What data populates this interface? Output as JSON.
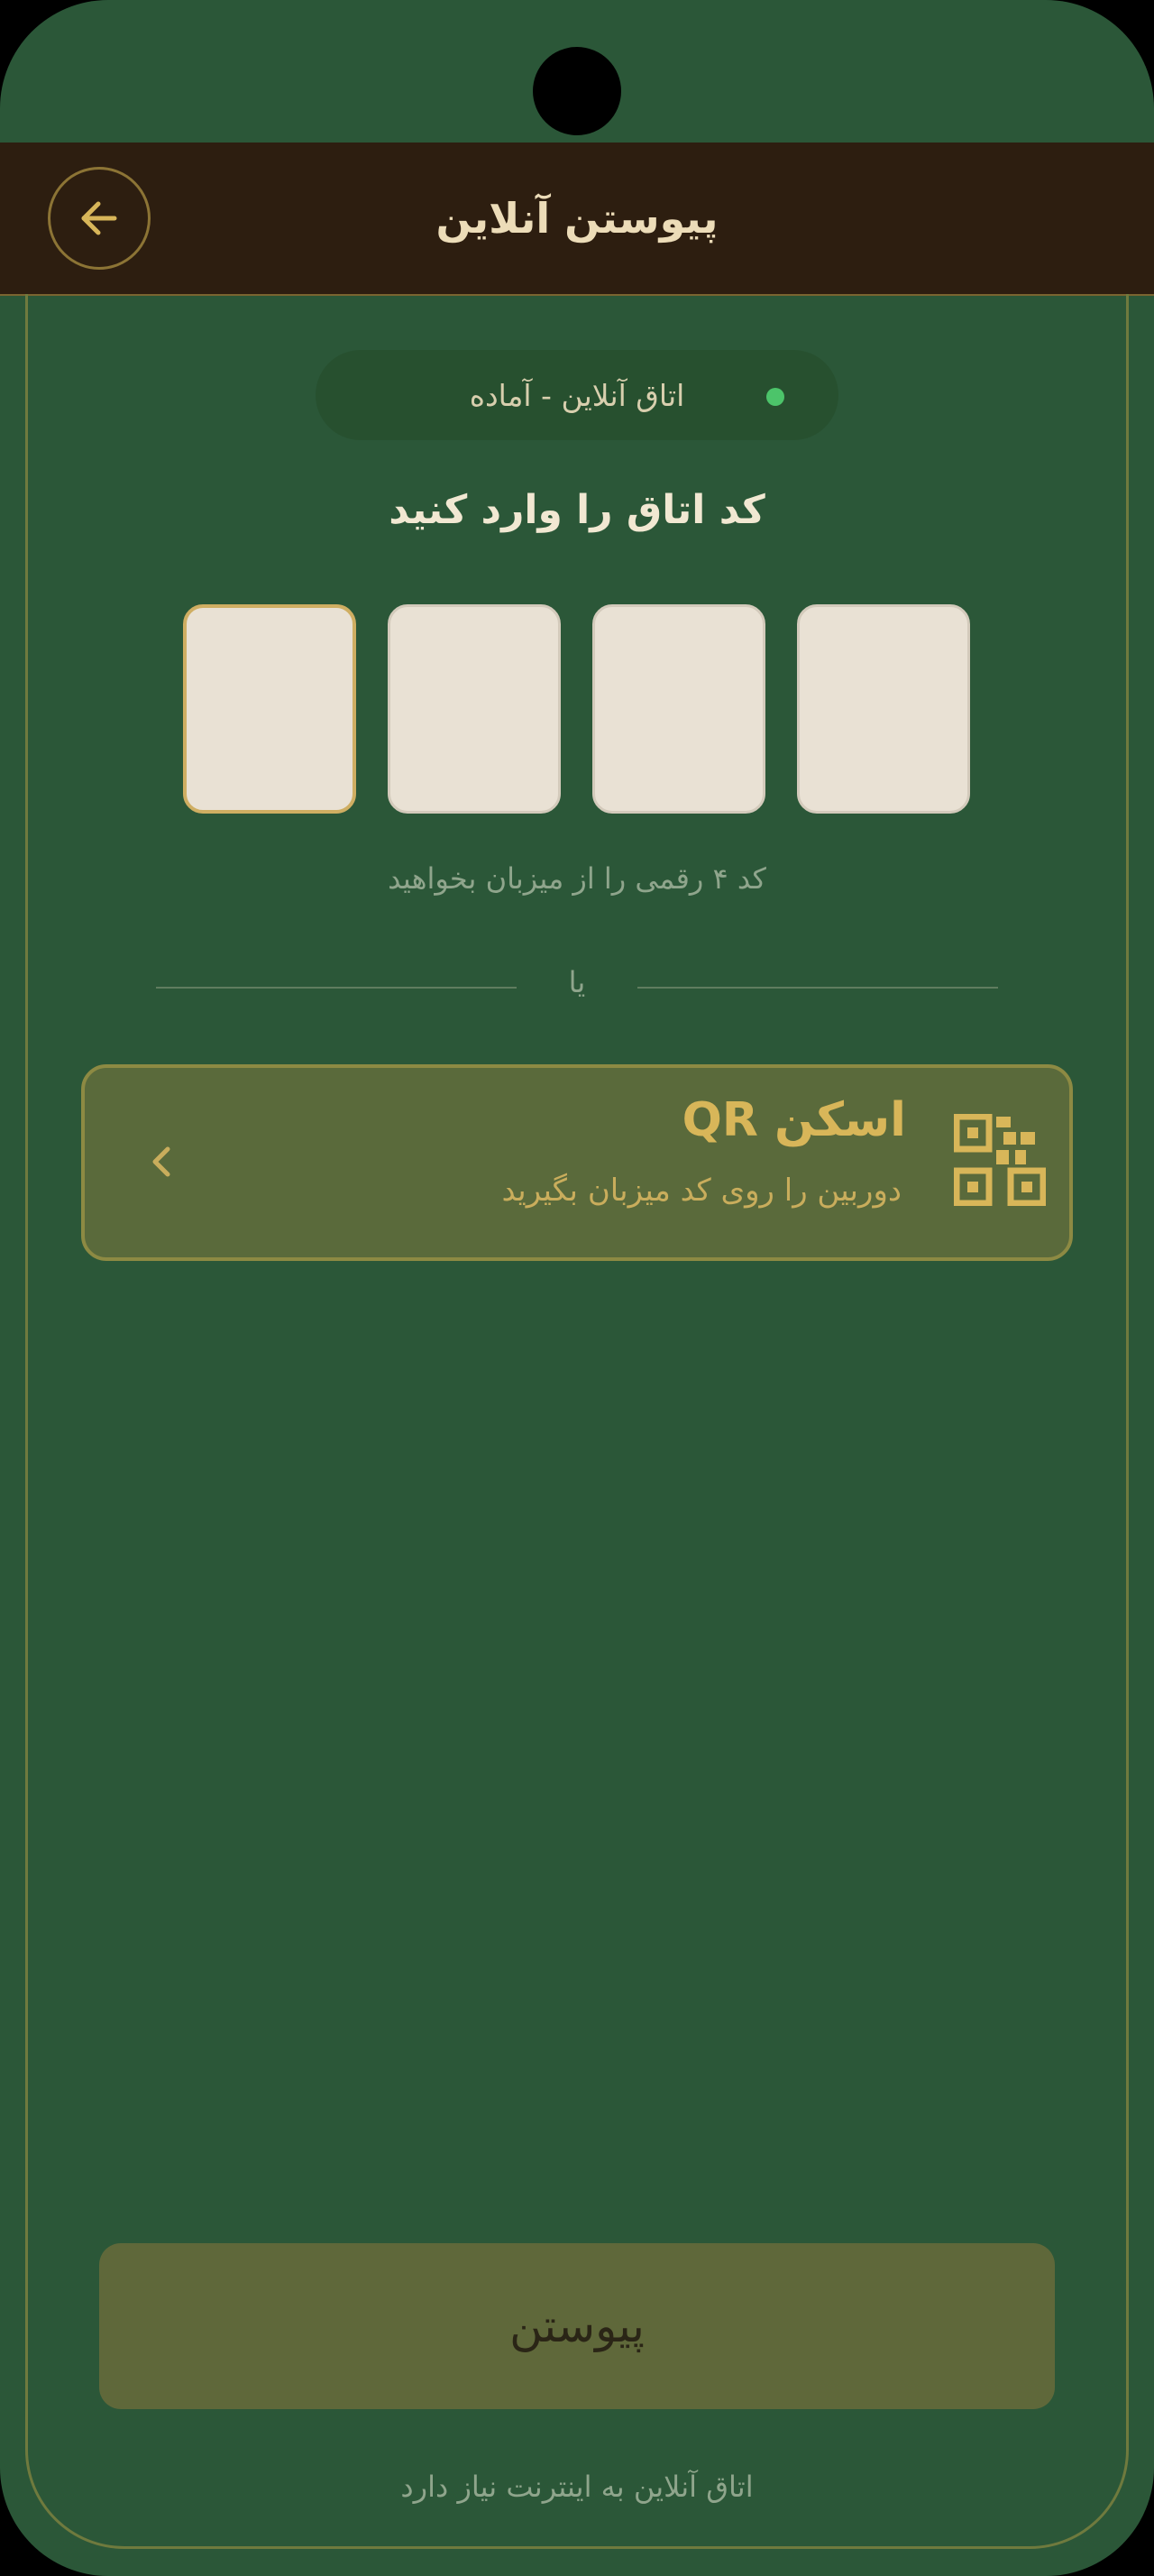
{
  "header": {
    "title": "پیوستن آنلاین",
    "back_icon": "arrow-left-icon"
  },
  "status": {
    "text": "اتاق آنلاین - آماده",
    "dot_color": "#4cc46a"
  },
  "code_entry": {
    "prompt": "کد اتاق را وارد کنید",
    "digits": [
      "",
      "",
      "",
      ""
    ],
    "hint": "کد ۴ رقمی را از میزبان بخواهید"
  },
  "divider": {
    "label": "یا"
  },
  "qr_card": {
    "title": "اسکن QR",
    "subtitle": "دوربین را روی کد میزبان بگیرید",
    "icon": "qr-code-icon",
    "chevron_icon": "chevron-left-icon"
  },
  "join_button": {
    "label": "پیوستن"
  },
  "footer": {
    "note": "اتاق آنلاین به اینترنت نیاز دارد"
  },
  "colors": {
    "background": "#2b5738",
    "header": "#2d1e10",
    "gold_accent": "#d8b659",
    "button": "#5f683a"
  }
}
